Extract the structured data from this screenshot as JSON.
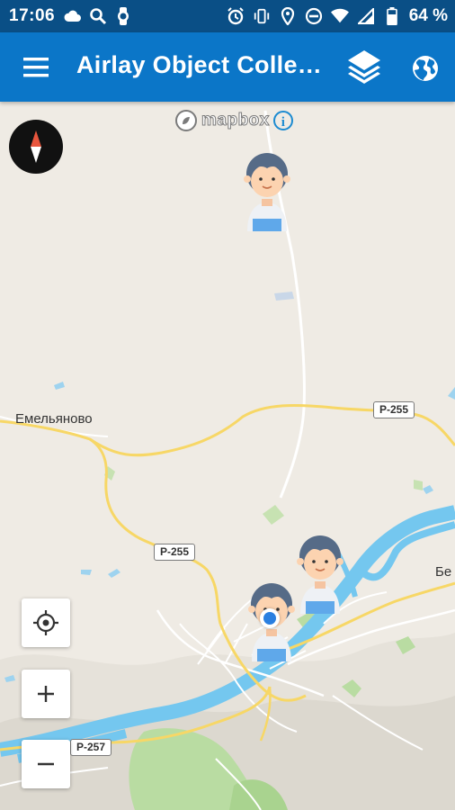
{
  "status_bar": {
    "time": "17:06",
    "battery": "64 %",
    "icons": [
      "cloud-icon",
      "search-icon",
      "watch-icon",
      "alarm-icon",
      "vibrate-icon",
      "location-icon",
      "dnd-icon",
      "wifi-icon",
      "signal-icon",
      "battery-icon"
    ]
  },
  "app_bar": {
    "title": "Airlay Object Colle…",
    "menu_icon": "menu-icon",
    "layers_icon": "layers-icon",
    "globe_icon": "globe-icon"
  },
  "map": {
    "attribution": "mapbox",
    "places": [
      {
        "name": "Емельяново"
      },
      {
        "name": "Бе"
      }
    ],
    "road_shields": [
      "P-255",
      "P-255",
      "P-257"
    ],
    "markers": [
      {
        "label": "person-marker"
      },
      {
        "label": "person-marker"
      },
      {
        "label": "person-marker"
      }
    ],
    "controls": {
      "locate_icon": "crosshair-icon",
      "zoom_in": "+",
      "zoom_out": "−"
    },
    "colors": {
      "land": "#efebe4",
      "water": "#74c7ef",
      "road_major": "#f7d766",
      "park": "#b9dca2",
      "app_bar": "#0b76c8",
      "status_bar": "#0a4f86"
    }
  }
}
